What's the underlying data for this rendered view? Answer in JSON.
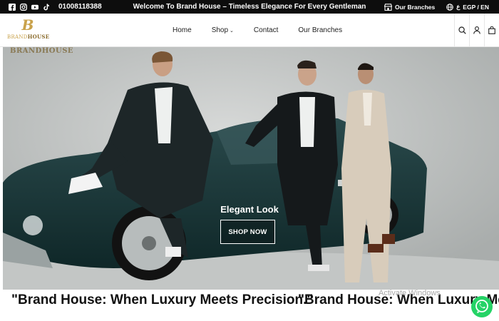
{
  "topbar": {
    "social": [
      "facebook-icon",
      "instagram-icon",
      "youtube-icon",
      "tiktok-icon"
    ],
    "phone": "01008118388",
    "welcome": "Welcome To Brand House – Timeless Elegance For Every Gentleman",
    "branches_label": "Our Branches",
    "currency_lang": "EGP / EN",
    "lang_prefix": "ع"
  },
  "header": {
    "logo_mark": "B",
    "logo_word_a": "BRAND",
    "logo_word_b": "HOUSE",
    "nav": [
      "Home",
      "Shop",
      "Contact",
      "Our Branches"
    ],
    "icons": [
      "search-icon",
      "user-icon",
      "bag-icon"
    ]
  },
  "hero": {
    "brand_tag": "BRANDHOUSE",
    "title": "Elegant Look",
    "cta": "SHOP NOW"
  },
  "marquee": {
    "text": "\"Brand House: When Luxury Meets Precision.\""
  },
  "overlay": {
    "activate": "Activate Windows"
  },
  "colors": {
    "accent_gold": "#c9a24b",
    "topbar_bg": "#0d0d0d",
    "whatsapp": "#25d366"
  }
}
